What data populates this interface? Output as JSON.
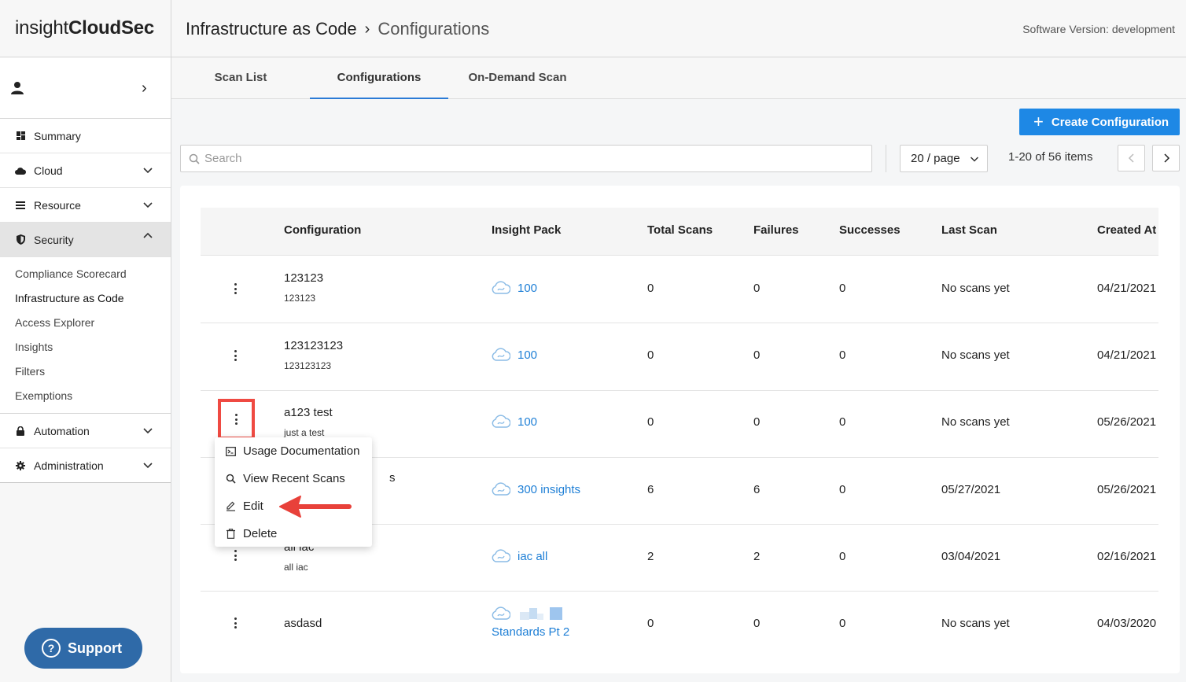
{
  "logo": {
    "light": "insight",
    "bold": "CloudSec"
  },
  "header": {
    "breadcrumb_parent": "Infrastructure as Code",
    "breadcrumb_current": "Configurations",
    "version": "Software Version: development"
  },
  "sidebar": {
    "items": [
      {
        "label": "Summary",
        "icon": "grid-icon"
      },
      {
        "label": "Cloud",
        "icon": "cloud-icon"
      },
      {
        "label": "Resource",
        "icon": "list-icon"
      },
      {
        "label": "Security",
        "icon": "shield-icon"
      }
    ],
    "security_sub": [
      "Compliance Scorecard",
      "Infrastructure as Code",
      "Access Explorer",
      "Insights",
      "Filters",
      "Exemptions"
    ],
    "bottom_items": [
      {
        "label": "Automation",
        "icon": "lock-icon"
      },
      {
        "label": "Administration",
        "icon": "gear-icon"
      }
    ],
    "support": "Support"
  },
  "tabs": [
    "Scan List",
    "Configurations",
    "On-Demand Scan"
  ],
  "toolbar": {
    "create_label": "Create Configuration",
    "search_placeholder": "Search",
    "per_page": "20 / page",
    "count": "1-20 of 56 items"
  },
  "table": {
    "columns": [
      "Configuration",
      "Insight Pack",
      "Total Scans",
      "Failures",
      "Successes",
      "Last Scan",
      "Created At"
    ],
    "rows": [
      {
        "name": "123123",
        "desc": "123123",
        "pack": "100",
        "total": "0",
        "failures": "0",
        "successes": "0",
        "last": "No scans yet",
        "created": "04/21/2021"
      },
      {
        "name": "123123123",
        "desc": "123123123",
        "pack": "100",
        "total": "0",
        "failures": "0",
        "successes": "0",
        "last": "No scans yet",
        "created": "04/21/2021"
      },
      {
        "name": "a123 test",
        "desc": "just a test",
        "pack": "100",
        "total": "0",
        "failures": "0",
        "successes": "0",
        "last": "No scans yet",
        "created": "05/26/2021"
      },
      {
        "name": "s",
        "desc": "",
        "pack": "300 insights",
        "total": "6",
        "failures": "6",
        "successes": "0",
        "last": "05/27/2021",
        "created": "05/26/2021"
      },
      {
        "name": "all iac",
        "desc": "all iac",
        "pack": "iac all",
        "total": "2",
        "failures": "2",
        "successes": "0",
        "last": "03/04/2021",
        "created": "02/16/2021"
      },
      {
        "name": "asdasd",
        "desc": "",
        "pack": "Standards Pt 2",
        "total": "0",
        "failures": "0",
        "successes": "0",
        "last": "No scans yet",
        "created": "04/03/2020"
      }
    ]
  },
  "menu": [
    "Usage Documentation",
    "View Recent Scans",
    "Edit",
    "Delete"
  ],
  "colors": {
    "accent": "#1e88e5",
    "link": "#1e7fd6",
    "highlight": "#ef4a42",
    "support": "#2f6aa8"
  }
}
